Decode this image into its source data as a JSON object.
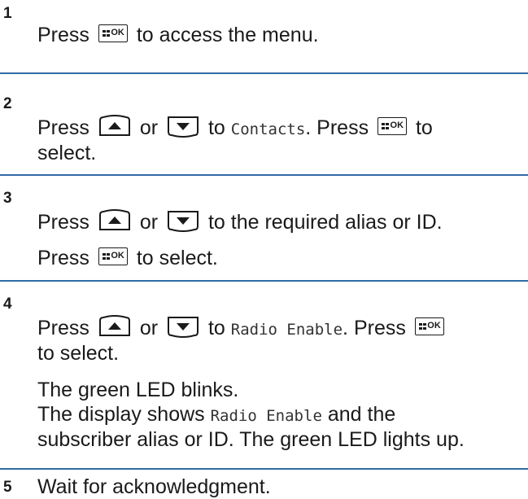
{
  "steps": [
    {
      "number": "1",
      "lines": [
        [
          "Press",
          "to access the menu."
        ]
      ]
    },
    {
      "number": "2",
      "l1_a": "Press",
      "l1_or": "or",
      "l1_to": "to",
      "l1_mono": "Contacts",
      "l1_b": ". Press",
      "l1_c": "to",
      "l2": "select."
    },
    {
      "number": "3",
      "l1_a": "Press",
      "l1_or": "or",
      "l1_b": "to the required alias or ID.",
      "l2_a": "Press",
      "l2_b": "to select."
    },
    {
      "number": "4",
      "l1_a": "Press",
      "l1_or": "or",
      "l1_to": "to",
      "l1_mono": "Radio Enable",
      "l1_b": ". Press",
      "l2": "to select.",
      "l3": "The green LED blinks.",
      "l4_a": "The display shows",
      "l4_mono": "Radio Enable",
      "l4_b": "and the",
      "l5": "subscriber alias or ID. The green LED lights up."
    },
    {
      "number": "5",
      "text": "Wait for acknowledgment."
    }
  ],
  "keys": {
    "ok_label": "OK",
    "up_icon": "up-arrow-key-icon",
    "down_icon": "down-arrow-key-icon",
    "menu_icon": "menu-ok-key-icon"
  },
  "colors": {
    "divider": "#2f6ba5",
    "text": "#1a1a1a"
  }
}
